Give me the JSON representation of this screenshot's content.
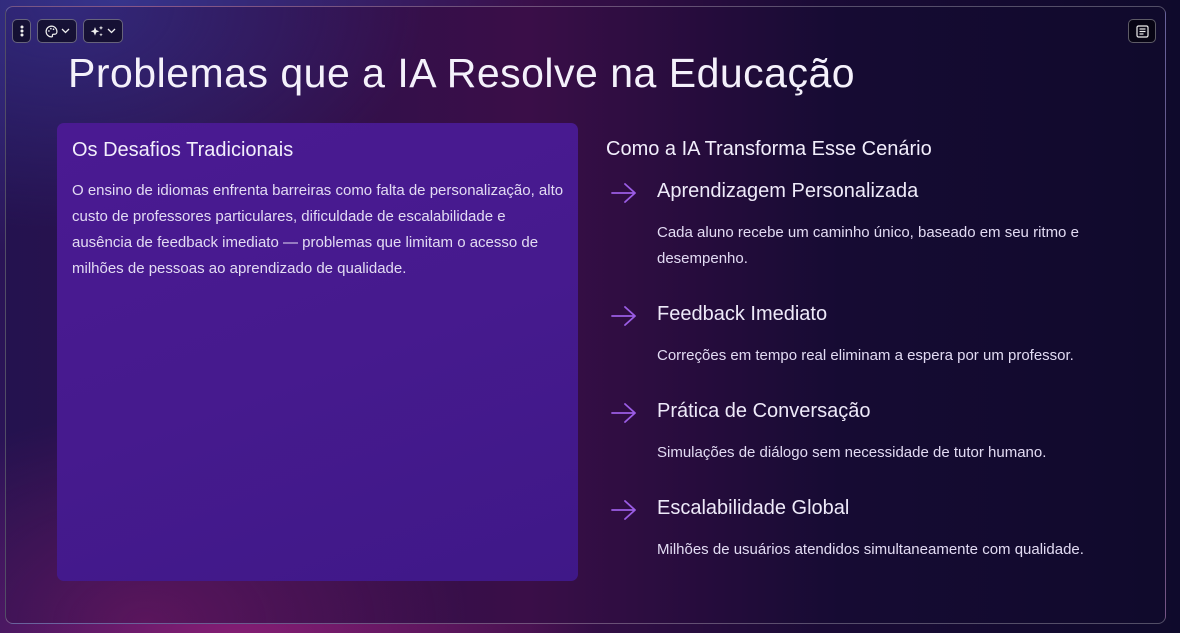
{
  "toolbar": {
    "menu_icon": "vertical-ellipsis-icon",
    "theme_icon": "palette-icon",
    "ai_icon": "sparkles-icon",
    "notes_icon": "notes-icon"
  },
  "slide": {
    "title": "Problemas que a IA Resolve na Educação",
    "left": {
      "heading": "Os Desafios Tradicionais",
      "body": "O ensino de idiomas enfrenta barreiras como falta de personalização, alto custo de professores particulares, dificuldade de escalabilidade e ausência de feedback imediato — problemas que limitam o acesso de milhões de pessoas ao aprendizado de qualidade."
    },
    "right": {
      "heading": "Como a IA Transforma Esse Cenário",
      "items": [
        {
          "title": "Aprendizagem Personalizada",
          "desc": "Cada aluno recebe um caminho único, baseado em seu ritmo e desempenho."
        },
        {
          "title": "Feedback Imediato",
          "desc": "Correções em tempo real eliminam a espera por um professor."
        },
        {
          "title": "Prática de Conversação",
          "desc": "Simulações de diálogo sem necessidade de tutor humano."
        },
        {
          "title": "Escalabilidade Global",
          "desc": "Milhões de usuários atendidos simultaneamente com qualidade."
        }
      ]
    }
  },
  "colors": {
    "accent_arrow": "#9b5de5",
    "panel": "#4a1a92"
  }
}
